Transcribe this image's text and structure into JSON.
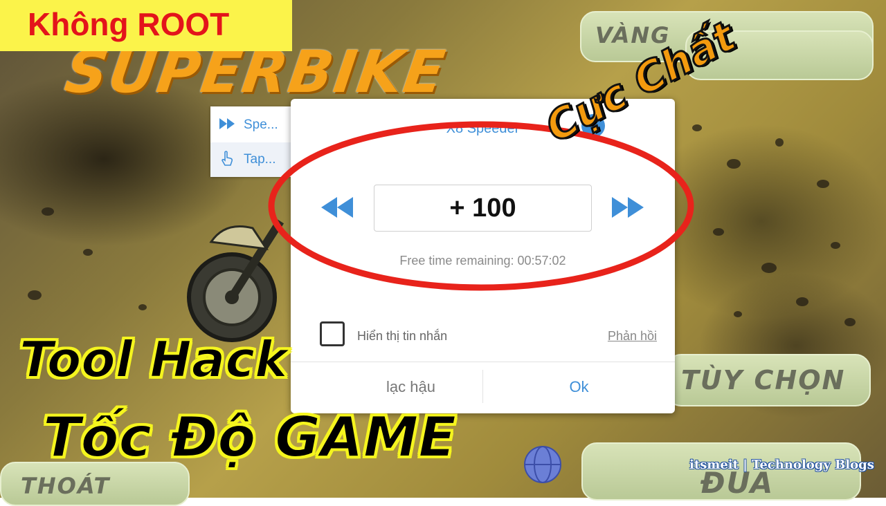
{
  "overlay_badge": {
    "text": "Không ROOT"
  },
  "game": {
    "title": "SUPERBIKE",
    "menu": {
      "gold": "VÀNG",
      "options": "TÙY CHỌN",
      "exit": "THOÁT",
      "race": "ĐUA"
    }
  },
  "side_menu": {
    "items": [
      {
        "label": "Spe...",
        "icon": "fast-forward-icon"
      },
      {
        "label": "Tap...",
        "icon": "tap-hand-icon"
      }
    ]
  },
  "dialog": {
    "title": "X8 Speeder",
    "value": "+ 100",
    "remaining": "Free time remaining: 00:57:02",
    "show_message_label": "Hiển thị tin nhắn",
    "feedback_link": "Phản hồi",
    "cancel_button": "lạc hậu",
    "ok_button": "Ok",
    "colors": {
      "accent": "#3f8fd8",
      "highlight_ring": "#e8231b"
    }
  },
  "promo": {
    "cuc_chat": "Cực Chất",
    "line1": "Tool Hack",
    "line2": "Tốc Độ GAME",
    "credit": "itsmeit | Technology Blogs"
  }
}
